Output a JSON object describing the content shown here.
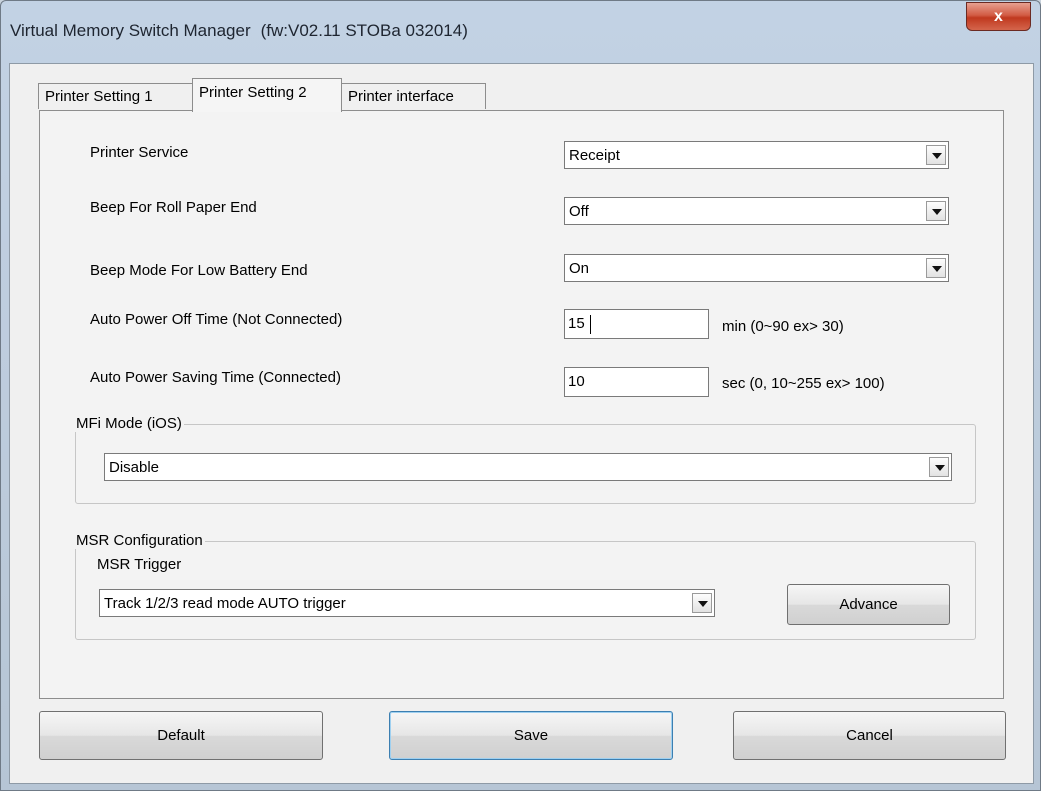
{
  "window": {
    "title": "Virtual Memory Switch Manager",
    "firmware": "(fw:V02.11 STOBa 032014)",
    "close_label": "x"
  },
  "tabs": [
    {
      "label": "Printer Setting 1",
      "active": false
    },
    {
      "label": "Printer Setting 2",
      "active": true
    },
    {
      "label": "Printer interface",
      "active": false
    }
  ],
  "settings": {
    "printer_service": {
      "label": "Printer Service",
      "value": "Receipt"
    },
    "beep_roll_paper_end": {
      "label": "Beep For Roll Paper End",
      "value": "Off"
    },
    "beep_low_battery": {
      "label": "Beep Mode For Low Battery End",
      "value": "On"
    },
    "auto_power_off": {
      "label": "Auto Power Off Time (Not Connected)",
      "value": "15",
      "hint": "min (0~90 ex> 30)"
    },
    "auto_power_saving": {
      "label": "Auto Power Saving Time (Connected)",
      "value": "10",
      "hint": "sec (0, 10~255 ex> 100)"
    }
  },
  "mfi": {
    "group_label": "MFi Mode (iOS)",
    "value": "Disable"
  },
  "msr": {
    "group_label": "MSR Configuration",
    "trigger_label": "MSR Trigger",
    "trigger_value": "Track 1/2/3 read mode AUTO trigger",
    "advance_label": "Advance"
  },
  "footer": {
    "default_label": "Default",
    "save_label": "Save",
    "cancel_label": "Cancel"
  }
}
